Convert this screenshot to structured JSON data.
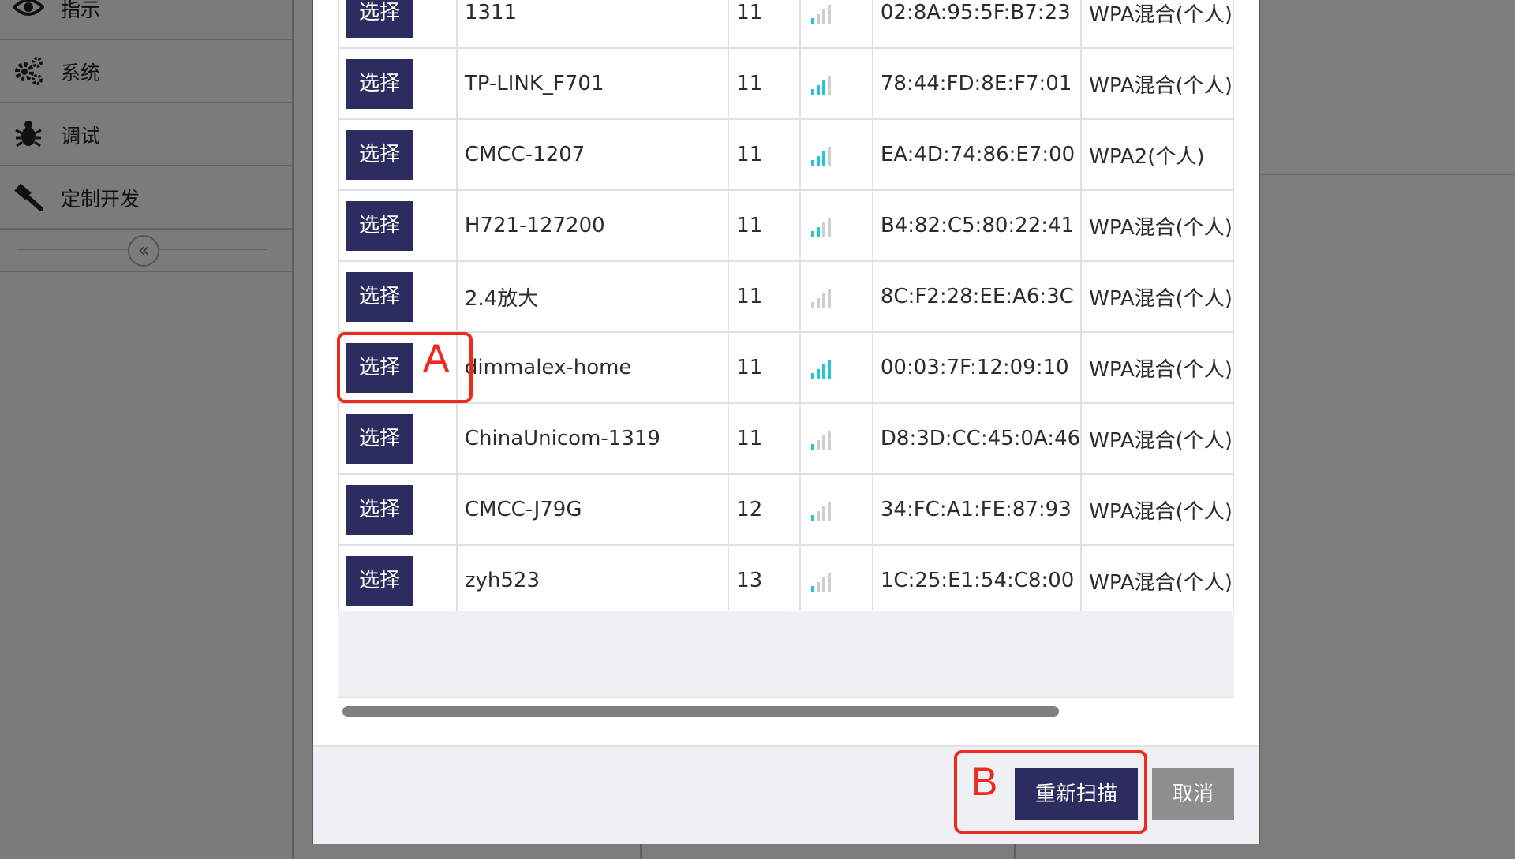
{
  "sidebar": {
    "items": [
      {
        "label": "指示",
        "icon": "eye-icon"
      },
      {
        "label": "系统",
        "icon": "gears-icon"
      },
      {
        "label": "调试",
        "icon": "bug-icon"
      },
      {
        "label": "定制开发",
        "icon": "hammer-icon"
      }
    ],
    "collapse_glyph": "«"
  },
  "wifi_list": {
    "select_label": "选择",
    "rows": [
      {
        "ssid": "1311",
        "channel": "11",
        "signal_bars": 1,
        "bssid": "02:8A:95:5F:B7:23",
        "security": "WPA混合(个人)"
      },
      {
        "ssid": "TP-LINK_F701",
        "channel": "11",
        "signal_bars": 3,
        "bssid": "78:44:FD:8E:F7:01",
        "security": "WPA混合(个人)"
      },
      {
        "ssid": "CMCC-1207",
        "channel": "11",
        "signal_bars": 3,
        "bssid": "EA:4D:74:86:E7:00",
        "security": "WPA2(个人)"
      },
      {
        "ssid": "H721-127200",
        "channel": "11",
        "signal_bars": 2,
        "bssid": "B4:82:C5:80:22:41",
        "security": "WPA混合(个人)"
      },
      {
        "ssid": "2.4放大",
        "channel": "11",
        "signal_bars": 0,
        "bssid": "8C:F2:28:EE:A6:3C",
        "security": "WPA混合(个人)"
      },
      {
        "ssid": "dimmalex-home",
        "channel": "11",
        "signal_bars": 4,
        "bssid": "00:03:7F:12:09:10",
        "security": "WPA混合(个人)"
      },
      {
        "ssid": "ChinaUnicom-1319",
        "channel": "11",
        "signal_bars": 1,
        "bssid": "D8:3D:CC:45:0A:46",
        "security": "WPA混合(个人)"
      },
      {
        "ssid": "CMCC-J79G",
        "channel": "12",
        "signal_bars": 1,
        "bssid": "34:FC:A1:FE:87:93",
        "security": "WPA混合(个人)"
      },
      {
        "ssid": "zyh523",
        "channel": "13",
        "signal_bars": 1,
        "bssid": "1C:25:E1:54:C8:00",
        "security": "WPA混合(个人)"
      }
    ]
  },
  "footer": {
    "rescan_label": "重新扫描",
    "cancel_label": "取消"
  },
  "annotations": {
    "a": "A",
    "b": "B",
    "color": "#ee2a1e"
  },
  "colors": {
    "button": "#2c2c60",
    "signal_on": "#23c7cf",
    "signal_off": "#cfcfcf",
    "overlay": "#7d7d7d"
  }
}
